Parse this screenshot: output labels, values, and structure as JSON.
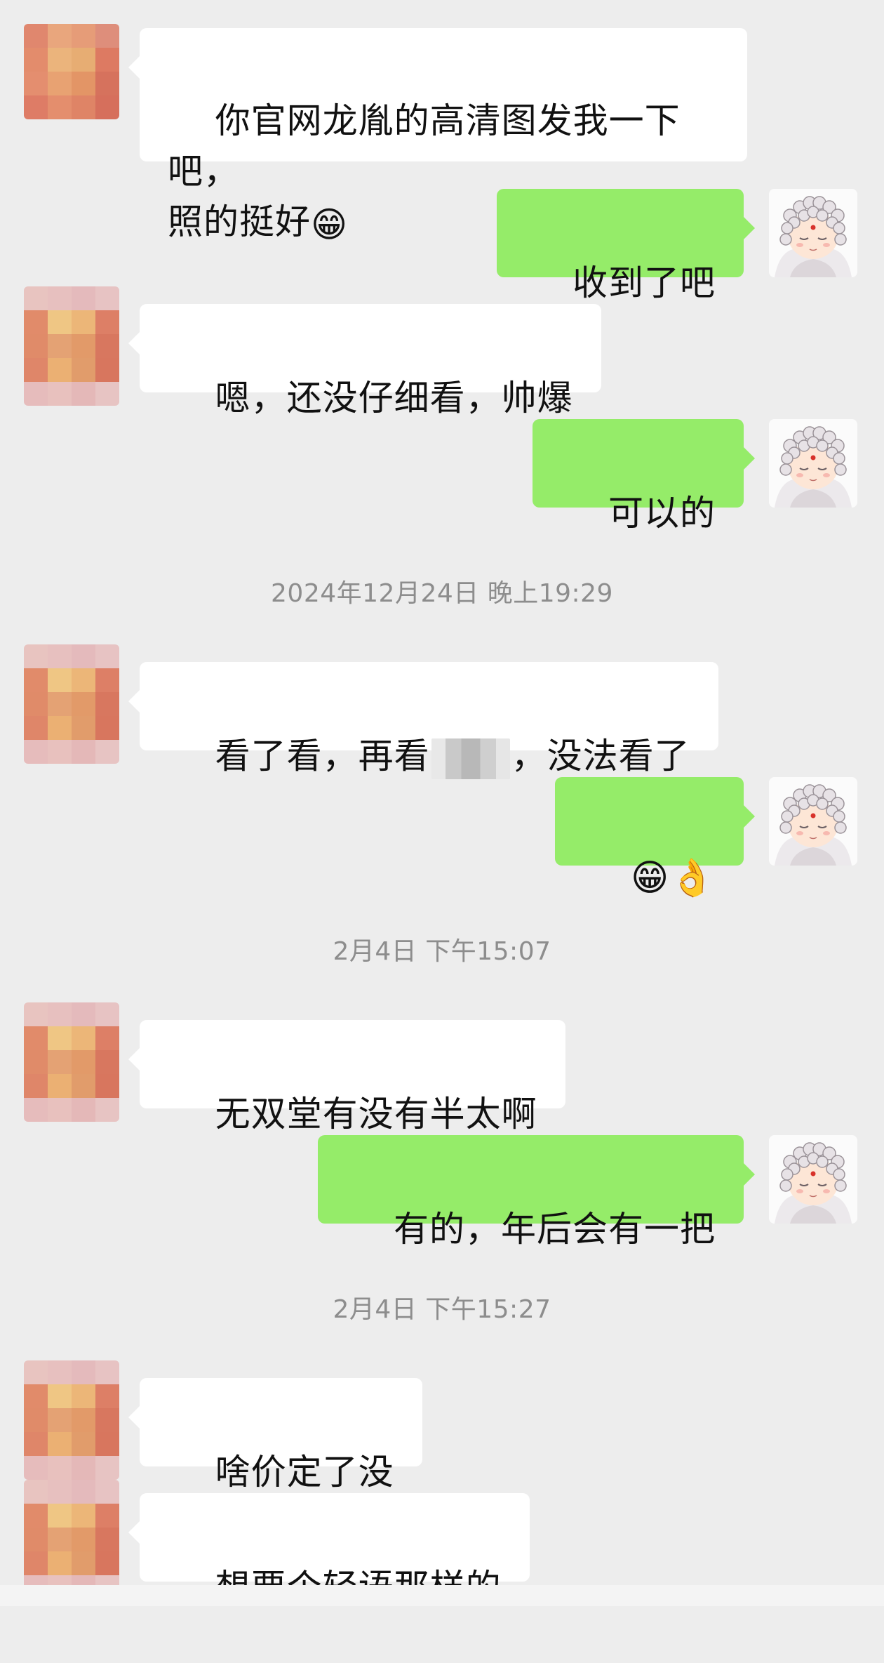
{
  "chat": {
    "messages": [
      {
        "side": "in",
        "parts": [
          {
            "text": "你官网龙胤的高清图发我一下吧，\n照的挺好"
          },
          {
            "emoji": "😁"
          }
        ]
      },
      {
        "side": "out",
        "text": "收到了吧"
      },
      {
        "side": "in",
        "text": "嗯，还没仔细看，帅爆"
      },
      {
        "side": "out",
        "text": "可以的"
      },
      {
        "side": "time",
        "text": "2024年12月24日 晚上19:29"
      },
      {
        "side": "in",
        "pre": "看了看，再看",
        "post": "，没法看了"
      },
      {
        "side": "out",
        "emojis": "😁👌"
      },
      {
        "side": "time",
        "text": "2月4日 下午15:07"
      },
      {
        "side": "in",
        "text": "无双堂有没有半太啊"
      },
      {
        "side": "out",
        "text": "有的，年后会有一把"
      },
      {
        "side": "time",
        "text": "2月4日 下午15:27"
      },
      {
        "side": "in",
        "text": "啥价定了没"
      },
      {
        "side": "in",
        "text": "想要个轻语那样的"
      }
    ]
  },
  "timestamps": {
    "t1": "2024年12月24日 晚上19:29",
    "t2": "2月4日 下午15:07",
    "t3": "2月4日 下午15:27"
  },
  "messages": {
    "m1_text": "你官网龙胤的高清图发我一下吧，\n照的挺好",
    "m1_emoji": "😁",
    "m2_text": "收到了吧",
    "m3_text": "嗯，还没仔细看，帅爆",
    "m4_text": "可以的",
    "m5_pre": "看了看，再看",
    "m5_post": "，没法看了",
    "m6_emojis": "😁👌",
    "m7_text": "无双堂有没有半太啊",
    "m8_text": "有的，年后会有一把",
    "m9_text": "啥价定了没",
    "m10_text": "想要个轻语那样的"
  },
  "colors": {
    "background": "#ededed",
    "incoming_bubble": "#ffffff",
    "outgoing_bubble": "#95ec69",
    "timestamp_text": "#8d8d8d"
  },
  "icons": {
    "contact_avatar": "pixelated-avatar",
    "self_avatar": "monk-avatar"
  }
}
